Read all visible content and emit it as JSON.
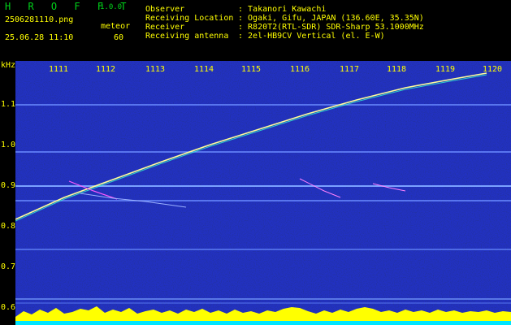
{
  "header": {
    "app_title": "H R O F F T",
    "version": "1.0.0",
    "filename": "2506281110.png",
    "mode": "meteor",
    "datetime": "25.06.28 11:10",
    "count": "60",
    "info_labels": [
      "Observer",
      "Receiving Location",
      "Receiver",
      "Receiving antenna"
    ],
    "info_values": [
      ": Takanori Kawachi",
      ": Ogaki, Gifu, JAPAN (136.60E, 35.35N)",
      ": R820T2(RTL-SDR) SDR-Sharp 53.1000MHz",
      ": 2el-HB9CV Vertical (el. E-W)"
    ]
  },
  "axis": {
    "unit": "kHz",
    "y_ticks": [
      "1.1",
      "1.0",
      "0.9",
      "0.8",
      "0.7",
      "0.6"
    ],
    "x_ticks": [
      "1111",
      "1112",
      "1113",
      "1114",
      "1115",
      "1116",
      "1117",
      "1118",
      "1119",
      "1120"
    ]
  },
  "colors": {
    "background": "#00007a",
    "text": "#ffff00",
    "title": "#00d21a",
    "band": "#6a8cff",
    "level": "#ffff00",
    "baseline": "#00e5ff"
  }
}
